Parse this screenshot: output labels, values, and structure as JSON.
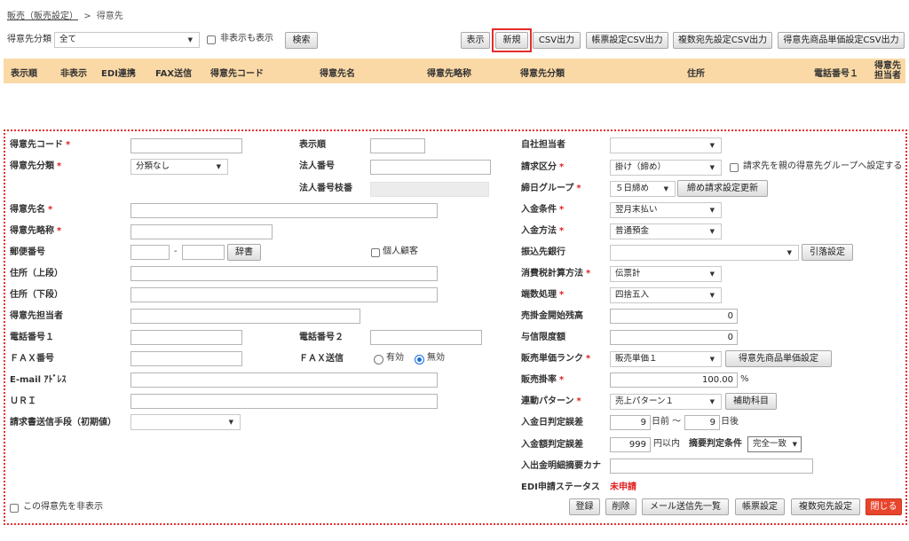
{
  "breadcrumb": {
    "parent": "販売（販売設定）",
    "separator": ">",
    "current": "得意先"
  },
  "filter": {
    "label": "得意先分類",
    "value": "全て",
    "show_hidden_label": "非表示も表示",
    "search_label": "検索"
  },
  "toolbar": {
    "display": "表示",
    "new": "新規",
    "csv": "CSV出力",
    "form_csv": "帳票設定CSV出力",
    "multi_dest_csv": "複数宛先設定CSV出力",
    "price_csv": "得意先商品単価設定CSV出力"
  },
  "columns": [
    "表示順",
    "非表示",
    "EDI連携",
    "FAX送信",
    "得意先コード",
    "得意先名",
    "得意先略称",
    "得意先分類",
    "住所",
    "電話番号１",
    "得意先",
    "担当者"
  ],
  "form": {
    "customer_code": "得意先コード",
    "customer_class": "得意先分類",
    "customer_class_value": "分類なし",
    "display_order": "表示順",
    "corp_number": "法人番号",
    "corp_branch": "法人番号枝番",
    "customer_name": "得意先名",
    "customer_short": "得意先略称",
    "postal": "郵便番号",
    "postal_sep": "-",
    "dict_button": "辞書",
    "individual": "個人顧客",
    "address1": "住所（上段）",
    "address2": "住所（下段）",
    "contact": "得意先担当者",
    "phone1": "電話番号１",
    "phone2": "電話番号２",
    "fax": "ＦＡＸ番号",
    "fax_send": "ＦＡＸ送信",
    "fax_on": "有効",
    "fax_off": "無効",
    "email": "E-mail ｱﾄﾞﾚｽ",
    "uri": "ＵＲＩ",
    "invoice_method": "請求書送信手段（初期値）",
    "hide_customer": "この得意先を非表示",
    "own_staff": "自社担当者",
    "billing_type": "請求区分",
    "billing_type_value": "掛け（締め）",
    "parent_group": "請求先を親の得意先グループへ設定する",
    "closing_group": "締日グループ",
    "closing_group_value": "５日締め",
    "closing_update_button": "締め請求設定更新",
    "payment_terms": "入金条件",
    "payment_terms_value": "翌月末払い",
    "payment_method": "入金方法",
    "payment_method_value": "普通預金",
    "bank": "振込先銀行",
    "debit_button": "引落設定",
    "tax_calc": "消費税計算方法",
    "tax_calc_value": "伝票計",
    "rounding": "端数処理",
    "rounding_value": "四捨五入",
    "ar_start": "売掛金開始残高",
    "ar_start_value": "0",
    "credit_limit": "与信限度額",
    "credit_limit_value": "0",
    "price_rank": "販売単価ランク",
    "price_rank_value": "販売単価１",
    "price_setting_button": "得意先商品単価設定",
    "sales_rate": "販売掛率",
    "sales_rate_value": "100.00",
    "percent": "%",
    "link_pattern": "連動パターン",
    "link_pattern_value": "売上パターン１",
    "aux_button": "補助科目",
    "date_tolerance": "入金日判定誤差",
    "days_before": "9",
    "days_before_suffix": "日前 〜",
    "days_after": "9",
    "days_after_suffix": "日後",
    "amount_tolerance": "入金額判定誤差",
    "amount_value": "999",
    "amount_suffix": "円以内",
    "summary_condition": "摘要判定条件",
    "summary_condition_value": "完全一致",
    "kana_summary": "入出金明細摘要カナ",
    "edi_status": "EDI申請ステータス",
    "edi_status_value": "未申請"
  },
  "footer": {
    "register": "登録",
    "delete": "削除",
    "mail_list": "メール送信先一覧",
    "form_setting": "帳票設定",
    "multi_dest": "複数宛先設定",
    "close": "閉じる"
  },
  "colors": {
    "header_bg": "#fbd9a6",
    "required": "#e02020",
    "highlight": "#e52c2c",
    "close_button": "#e8452c",
    "status_red": "#e02020"
  }
}
